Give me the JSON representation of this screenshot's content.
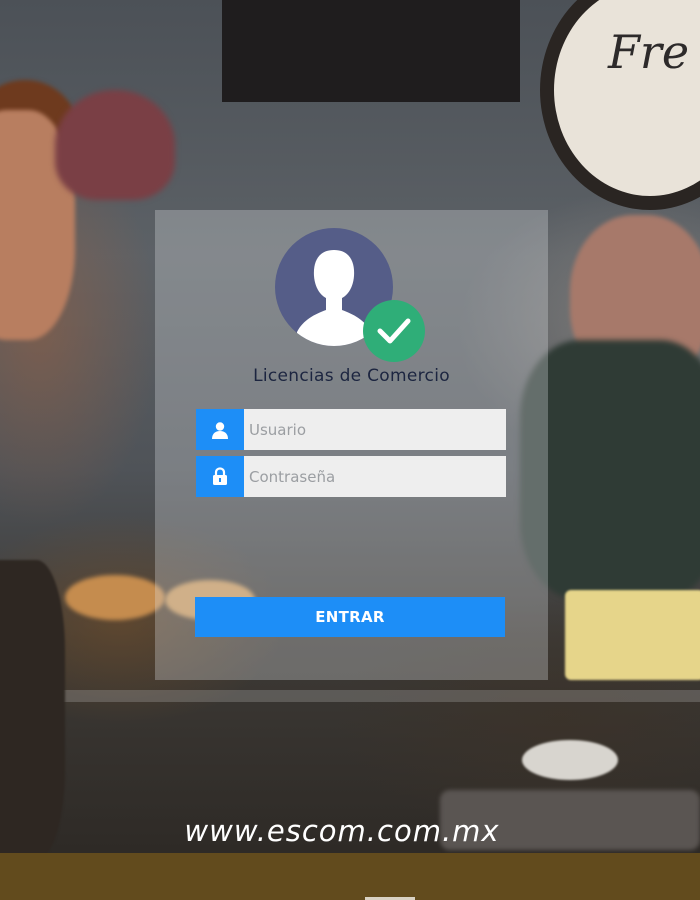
{
  "app": {
    "title": "Licencias de Comercio"
  },
  "login": {
    "username_placeholder": "Usuario",
    "username_value": "",
    "password_placeholder": "Contraseña",
    "password_value": "",
    "submit_label": "ENTRAR"
  },
  "footer": {
    "url_text": "www.escom.com.mx"
  },
  "colors": {
    "accent": "#1d8ef7",
    "avatar": "#555d88",
    "check_badge": "#2fae78",
    "footer_bar": "#624b1d"
  },
  "icons": {
    "avatar": "user-avatar-icon",
    "badge": "check-icon",
    "username": "user-icon",
    "password": "lock-icon"
  }
}
